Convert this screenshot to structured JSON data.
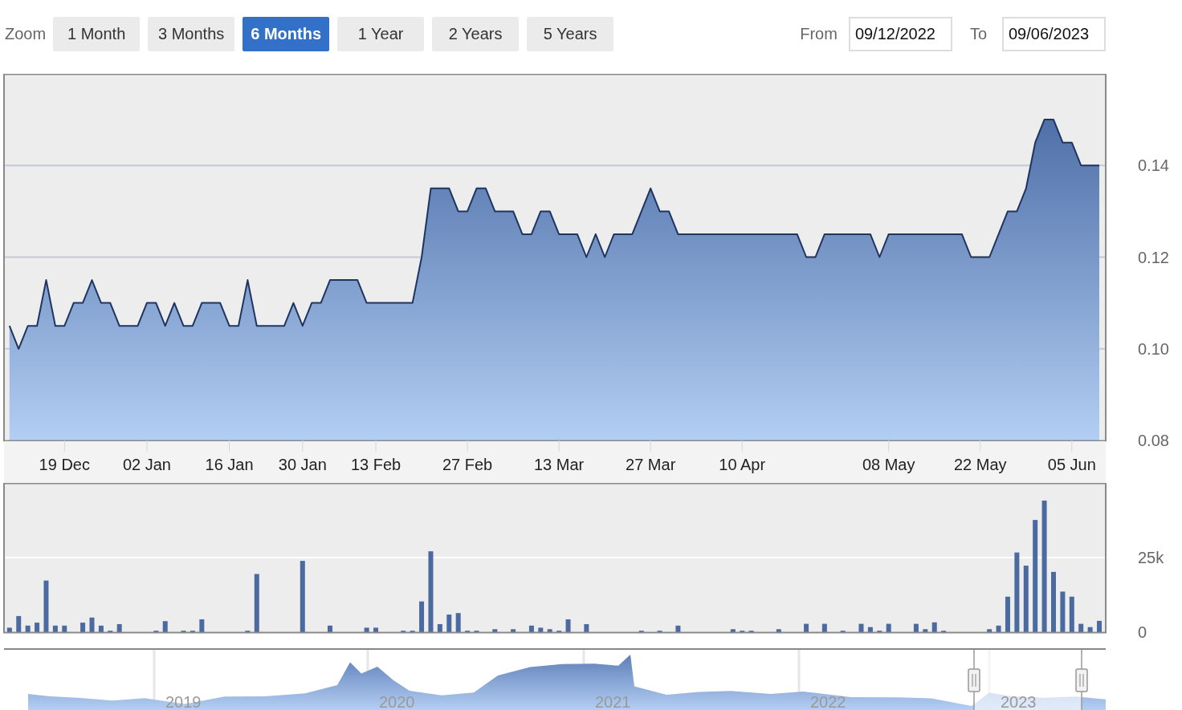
{
  "toolbar": {
    "zoom_label": "Zoom",
    "buttons": [
      {
        "label": "1 Month",
        "selected": false
      },
      {
        "label": "3 Months",
        "selected": false
      },
      {
        "label": "6 Months",
        "selected": true
      },
      {
        "label": "1 Year",
        "selected": false
      },
      {
        "label": "2 Years",
        "selected": false
      },
      {
        "label": "5 Years",
        "selected": false
      }
    ],
    "from_label": "From",
    "from_date": "09/12/2022",
    "to_label": "To",
    "to_date": "09/06/2023"
  },
  "price_chart": {
    "chart_data": {
      "type": "area",
      "categories": [
        null,
        null,
        null,
        null,
        null,
        null,
        "19 Dec",
        null,
        null,
        null,
        null,
        null,
        null,
        null,
        null,
        "02 Jan",
        null,
        null,
        null,
        null,
        null,
        null,
        null,
        null,
        "16 Jan",
        null,
        null,
        null,
        null,
        null,
        null,
        null,
        "30 Jan",
        null,
        null,
        null,
        null,
        null,
        null,
        null,
        "13 Feb",
        null,
        null,
        null,
        null,
        null,
        null,
        null,
        null,
        null,
        "27 Feb",
        null,
        null,
        null,
        null,
        null,
        null,
        null,
        null,
        null,
        "13 Mar",
        null,
        null,
        null,
        null,
        null,
        null,
        null,
        null,
        null,
        "27 Mar",
        null,
        null,
        null,
        null,
        null,
        null,
        null,
        null,
        null,
        "10 Apr",
        null,
        null,
        null,
        null,
        null,
        null,
        null,
        null,
        null,
        null,
        null,
        null,
        null,
        null,
        null,
        "08 May",
        null,
        null,
        null,
        null,
        null,
        null,
        null,
        null,
        null,
        "22 May",
        null,
        null,
        null,
        null,
        null,
        null,
        null,
        null,
        null,
        "05 Jun",
        null,
        null,
        null
      ],
      "values": [
        0.105,
        0.1,
        0.105,
        0.105,
        0.115,
        0.105,
        0.105,
        0.11,
        0.11,
        0.115,
        0.11,
        0.11,
        0.105,
        0.105,
        0.105,
        0.11,
        0.11,
        0.105,
        0.11,
        0.105,
        0.105,
        0.11,
        0.11,
        0.11,
        0.105,
        0.105,
        0.115,
        0.105,
        0.105,
        0.105,
        0.105,
        0.11,
        0.105,
        0.11,
        0.11,
        0.115,
        0.115,
        0.115,
        0.115,
        0.11,
        0.11,
        0.11,
        0.11,
        0.11,
        0.11,
        0.12,
        0.135,
        0.135,
        0.135,
        0.13,
        0.13,
        0.135,
        0.135,
        0.13,
        0.13,
        0.13,
        0.125,
        0.125,
        0.13,
        0.13,
        0.125,
        0.125,
        0.125,
        0.12,
        0.125,
        0.12,
        0.125,
        0.125,
        0.125,
        0.13,
        0.135,
        0.13,
        0.13,
        0.125,
        0.125,
        0.125,
        0.125,
        0.125,
        0.125,
        0.125,
        0.125,
        0.125,
        0.125,
        0.125,
        0.125,
        0.125,
        0.125,
        0.12,
        0.12,
        0.125,
        0.125,
        0.125,
        0.125,
        0.125,
        0.125,
        0.12,
        0.125,
        0.125,
        0.125,
        0.125,
        0.125,
        0.125,
        0.125,
        0.125,
        0.125,
        0.12,
        0.12,
        0.12,
        0.125,
        0.13,
        0.13,
        0.135,
        0.145,
        0.15,
        0.15,
        0.145,
        0.145,
        0.14,
        0.14,
        0.14
      ],
      "ylim": [
        0.08,
        0.16
      ],
      "grid": true,
      "yticks": [
        {
          "value": 0.08,
          "label": "0.08"
        },
        {
          "value": 0.1,
          "label": "0.10"
        },
        {
          "value": 0.12,
          "label": "0.12"
        },
        {
          "value": 0.14,
          "label": "0.14"
        }
      ]
    }
  },
  "volume_chart": {
    "chart_data": {
      "type": "bar",
      "categories": [
        null,
        null,
        null,
        null,
        null,
        null,
        null,
        null,
        null,
        null,
        null,
        null,
        null,
        null,
        null,
        null,
        null,
        null,
        null,
        null,
        null,
        null,
        null,
        null,
        null,
        null,
        null,
        null,
        null,
        null,
        null,
        null,
        null,
        null,
        null,
        null,
        null,
        null,
        null,
        null,
        null,
        null,
        null,
        null,
        null,
        null,
        null,
        null,
        null,
        null,
        null,
        null,
        null,
        null,
        null,
        null,
        null,
        null,
        null,
        null,
        null,
        null,
        null,
        null,
        null,
        null,
        null,
        null,
        null,
        null,
        null,
        null,
        null,
        null,
        null,
        null,
        null,
        null,
        null,
        null,
        null,
        null,
        null,
        null,
        null,
        null,
        null,
        null,
        null,
        null,
        null,
        null,
        null,
        null,
        null,
        null,
        null,
        null,
        null,
        null,
        null,
        null,
        null,
        null,
        null,
        null,
        null,
        null,
        null,
        null,
        null,
        null,
        null,
        null,
        null,
        null,
        null,
        null,
        null,
        null
      ],
      "values": [
        1500,
        5400,
        2200,
        3200,
        17300,
        2200,
        2200,
        0,
        3200,
        4900,
        2200,
        500,
        2700,
        0,
        0,
        0,
        500,
        3700,
        0,
        500,
        500,
        4300,
        0,
        0,
        0,
        0,
        500,
        19500,
        0,
        0,
        0,
        0,
        23900,
        0,
        0,
        2200,
        0,
        0,
        0,
        1500,
        1500,
        0,
        0,
        500,
        500,
        10300,
        27100,
        2700,
        5900,
        6400,
        500,
        500,
        0,
        1000,
        0,
        1000,
        0,
        2200,
        1500,
        1000,
        500,
        4300,
        0,
        2700,
        0,
        0,
        0,
        0,
        0,
        500,
        0,
        500,
        0,
        2200,
        0,
        0,
        0,
        0,
        0,
        1000,
        500,
        500,
        0,
        0,
        1000,
        0,
        0,
        2800,
        0,
        2800,
        0,
        500,
        0,
        2800,
        1700,
        500,
        2800,
        0,
        0,
        2800,
        1000,
        3300,
        500,
        0,
        0,
        0,
        0,
        1000,
        2200,
        11900,
        26700,
        22300,
        37600,
        44100,
        20200,
        13600,
        11900,
        2800,
        1700,
        3800
      ],
      "ylim": [
        0,
        50000
      ],
      "grid": true,
      "yticks": [
        {
          "value": 0,
          "label": "0"
        },
        {
          "value": 25000,
          "label": "25k"
        }
      ]
    }
  },
  "navigator": {
    "year_labels": [
      "2019",
      "2020",
      "2021",
      "2022",
      "2023"
    ]
  }
}
